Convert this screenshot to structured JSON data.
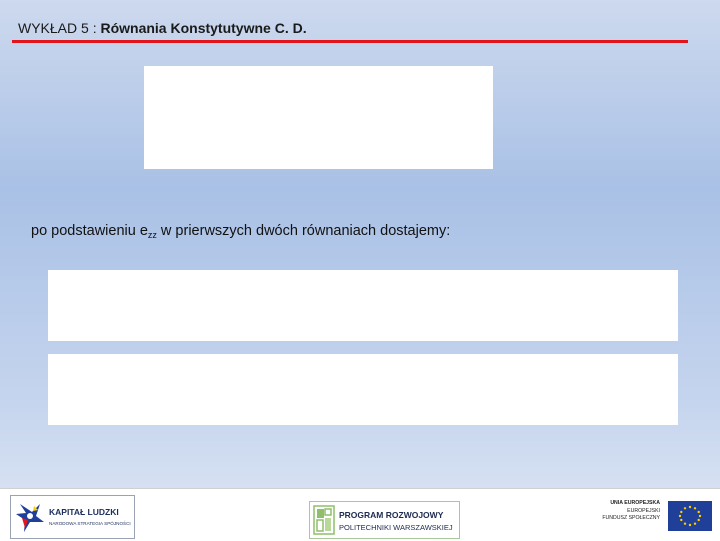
{
  "header": {
    "prefix": "WYKŁAD 5 : ",
    "title": "Równania Konstytutywne C. D."
  },
  "body": {
    "text_before": "po podstawieniu e",
    "subscript": "zz",
    "text_after": " w prierwszych dwóch równaniach dostajemy:"
  },
  "footer": {
    "logo_kapital": {
      "title": "KAPITAŁ LUDZKI",
      "subtitle": "NARODOWA STRATEGIA SPÓJNOŚCI"
    },
    "logo_program": {
      "title": "PROGRAM ROZWOJOWY",
      "subtitle": "POLITECHNIKI WARSZAWSKIEJ"
    },
    "logo_ue": {
      "line1": "UNIA EUROPEJSKA",
      "line2": "EUROPEJSKI",
      "line3": "FUNDUSZ SPOŁECZNY"
    }
  },
  "colors": {
    "accent_red": "#e3151c",
    "eu_blue": "#1f3f99",
    "eu_gold": "#ffcc00"
  }
}
